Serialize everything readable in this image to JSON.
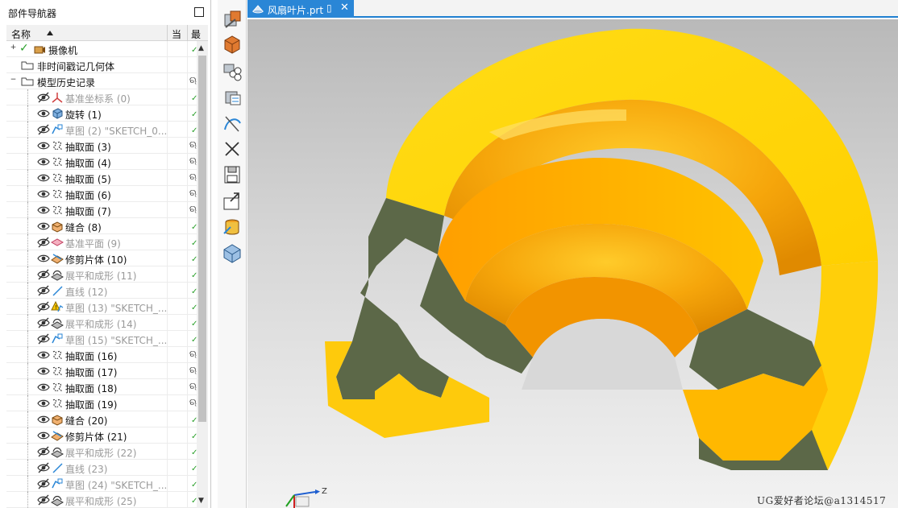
{
  "navigator": {
    "title": "部件导航器",
    "columns": {
      "name": "名称",
      "current": "当",
      "latest": "最"
    },
    "rows": [
      {
        "label": "摄像机",
        "type": "camera",
        "level": 0,
        "expander": "+",
        "gray": false,
        "status": "check"
      },
      {
        "label": "非时间戳记几何体",
        "type": "folder",
        "level": 0,
        "expander": "",
        "gray": false,
        "status": ""
      },
      {
        "label": "模型历史记录",
        "type": "folder",
        "level": 0,
        "expander": "−",
        "gray": false,
        "status": "link"
      },
      {
        "label": "基准坐标系 (0)",
        "type": "csys",
        "level": 1,
        "gray": true,
        "status": "check"
      },
      {
        "label": "旋转 (1)",
        "type": "revolve",
        "level": 1,
        "gray": false,
        "status": "check"
      },
      {
        "label": "草图 (2) \"SKETCH_0...",
        "type": "sketch",
        "level": 1,
        "gray": true,
        "status": "check"
      },
      {
        "label": "抽取面 (3)",
        "type": "extract",
        "level": 1,
        "gray": false,
        "status": "link"
      },
      {
        "label": "抽取面 (4)",
        "type": "extract",
        "level": 1,
        "gray": false,
        "status": "link"
      },
      {
        "label": "抽取面 (5)",
        "type": "extract",
        "level": 1,
        "gray": false,
        "status": "link"
      },
      {
        "label": "抽取面 (6)",
        "type": "extract",
        "level": 1,
        "gray": false,
        "status": "link"
      },
      {
        "label": "抽取面 (7)",
        "type": "extract",
        "level": 1,
        "gray": false,
        "status": "link"
      },
      {
        "label": "缝合 (8)",
        "type": "sew",
        "level": 1,
        "gray": false,
        "status": "check"
      },
      {
        "label": "基准平面 (9)",
        "type": "plane",
        "level": 1,
        "gray": true,
        "status": "check"
      },
      {
        "label": "修剪片体 (10)",
        "type": "trim",
        "level": 1,
        "gray": false,
        "status": "check"
      },
      {
        "label": "展平和成形 (11)",
        "type": "flatten",
        "level": 1,
        "gray": true,
        "status": "check"
      },
      {
        "label": "直线 (12)",
        "type": "line",
        "level": 1,
        "gray": true,
        "status": "check"
      },
      {
        "label": "草图 (13) \"SKETCH_...",
        "type": "sketch-warn",
        "level": 1,
        "gray": true,
        "status": "check"
      },
      {
        "label": "展平和成形 (14)",
        "type": "flatten",
        "level": 1,
        "gray": true,
        "status": "check"
      },
      {
        "label": "草图 (15) \"SKETCH_...",
        "type": "sketch",
        "level": 1,
        "gray": true,
        "status": "check"
      },
      {
        "label": "抽取面 (16)",
        "type": "extract",
        "level": 1,
        "gray": false,
        "status": "link"
      },
      {
        "label": "抽取面 (17)",
        "type": "extract",
        "level": 1,
        "gray": false,
        "status": "link"
      },
      {
        "label": "抽取面 (18)",
        "type": "extract",
        "level": 1,
        "gray": false,
        "status": "link"
      },
      {
        "label": "抽取面 (19)",
        "type": "extract",
        "level": 1,
        "gray": false,
        "status": "link"
      },
      {
        "label": "缝合 (20)",
        "type": "sew",
        "level": 1,
        "gray": false,
        "status": "check"
      },
      {
        "label": "修剪片体 (21)",
        "type": "trim",
        "level": 1,
        "gray": false,
        "status": "check"
      },
      {
        "label": "展平和成形 (22)",
        "type": "flatten",
        "level": 1,
        "gray": true,
        "status": "check"
      },
      {
        "label": "直线 (23)",
        "type": "line",
        "level": 1,
        "gray": true,
        "status": "check"
      },
      {
        "label": "草图 (24) \"SKETCH_...",
        "type": "sketch",
        "level": 1,
        "gray": true,
        "status": "check"
      },
      {
        "label": "展平和成形 (25)",
        "type": "flatten",
        "level": 1,
        "gray": true,
        "status": "check"
      }
    ]
  },
  "resource_bar": {
    "icons": [
      "assembly-navigator-icon",
      "constraint-navigator-icon",
      "part-navigator-icon",
      "reuse-library-icon",
      "hd3d-tools-icon",
      "web-browser-close-icon",
      "history-save-icon",
      "process-studio-icon",
      "system-materials-icon",
      "roles-icon"
    ]
  },
  "graphics": {
    "tab_title": "风扇叶片.prt",
    "tab_pin": "▯",
    "tab_close": "✕",
    "triad_z": "Z",
    "watermark": "UG爱好者论坛@a1314517"
  },
  "colors": {
    "accent": "#2a86d6",
    "model_face": "#ffd20a",
    "model_face_dark": "#f7a400",
    "model_section": "#5c6848",
    "check": "#2aa02a"
  }
}
